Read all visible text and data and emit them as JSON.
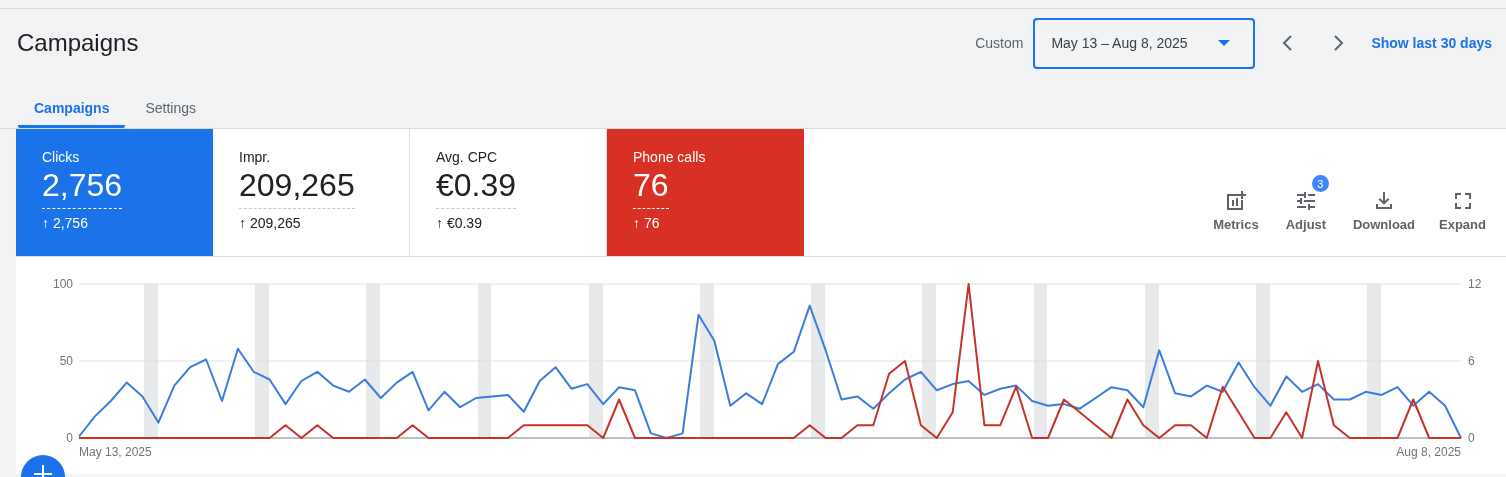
{
  "header": {
    "title": "Campaigns",
    "range_label": "Custom",
    "date_range": "May 13 – Aug 8, 2025",
    "link": "Show last 30 days"
  },
  "tabs": [
    {
      "label": "Campaigns",
      "selected": true
    },
    {
      "label": "Settings",
      "selected": false
    }
  ],
  "metrics": [
    {
      "label": "Clicks",
      "value": "2,756",
      "change": "↑ 2,756",
      "selected": true,
      "color": "#1a73e8"
    },
    {
      "label": "Impr.",
      "value": "209,265",
      "change": "↑ 209,265",
      "selected": false
    },
    {
      "label": "Avg. CPC",
      "value": "€0.39",
      "change": "↑ €0.39",
      "selected": false
    },
    {
      "label": "Phone calls",
      "value": "76",
      "change": "↑ 76",
      "selected": true,
      "color": "#d93025"
    }
  ],
  "tools": [
    {
      "kind": "metrics",
      "label": "Metrics"
    },
    {
      "kind": "adjust",
      "label": "Adjust",
      "badge": "3"
    },
    {
      "kind": "download",
      "label": "Download"
    },
    {
      "kind": "expand",
      "label": "Expand"
    }
  ],
  "chart": {
    "start_label": "May 13, 2025",
    "end_label": "Aug 8, 2025",
    "chart_data": {
      "type": "line",
      "ylim": [
        0,
        100
      ],
      "yticks": [
        0,
        50,
        100
      ],
      "y2lim": [
        0,
        12
      ],
      "y2ticks": [
        0,
        6,
        12
      ],
      "series": [
        {
          "color": "#3b7ddd",
          "values": [
            1,
            14,
            24,
            36,
            27,
            10,
            34,
            46,
            51,
            24,
            58,
            43,
            38,
            22,
            37,
            43,
            34,
            30,
            38,
            26,
            36,
            43,
            18,
            30,
            20,
            26,
            27,
            28,
            17,
            37,
            46,
            32,
            35,
            22,
            33,
            31,
            3,
            0,
            3,
            80,
            63,
            21,
            29,
            22,
            48,
            56,
            86,
            57,
            25,
            27,
            19,
            29,
            38,
            43,
            31,
            35,
            37,
            28,
            32,
            34,
            24,
            21,
            22,
            19,
            26,
            33,
            31,
            20,
            57,
            29,
            27,
            34,
            30,
            49,
            33,
            21,
            40,
            30,
            35,
            25,
            25,
            30,
            28,
            33,
            21,
            30,
            21,
            0
          ]
        },
        {
          "color": "#c5332b",
          "axis": "y2",
          "values": [
            0,
            0,
            0,
            0,
            0,
            0,
            0,
            0,
            0,
            0,
            0,
            0,
            0,
            1,
            0,
            1,
            0,
            0,
            0,
            0,
            0,
            1,
            0,
            0,
            0,
            0,
            0,
            0,
            1,
            1,
            1,
            1,
            1,
            0,
            3,
            0,
            0,
            0,
            0,
            0,
            0,
            0,
            0,
            0,
            0,
            0,
            1,
            0,
            0,
            1,
            1,
            5,
            6,
            1,
            0,
            2,
            12,
            1,
            1,
            4,
            0,
            0,
            3,
            2,
            1,
            0,
            3,
            1,
            0,
            1,
            1,
            0,
            4,
            2,
            0,
            0,
            2,
            0,
            6,
            1,
            0,
            0,
            0,
            0,
            3,
            0,
            0,
            0
          ]
        }
      ]
    }
  }
}
